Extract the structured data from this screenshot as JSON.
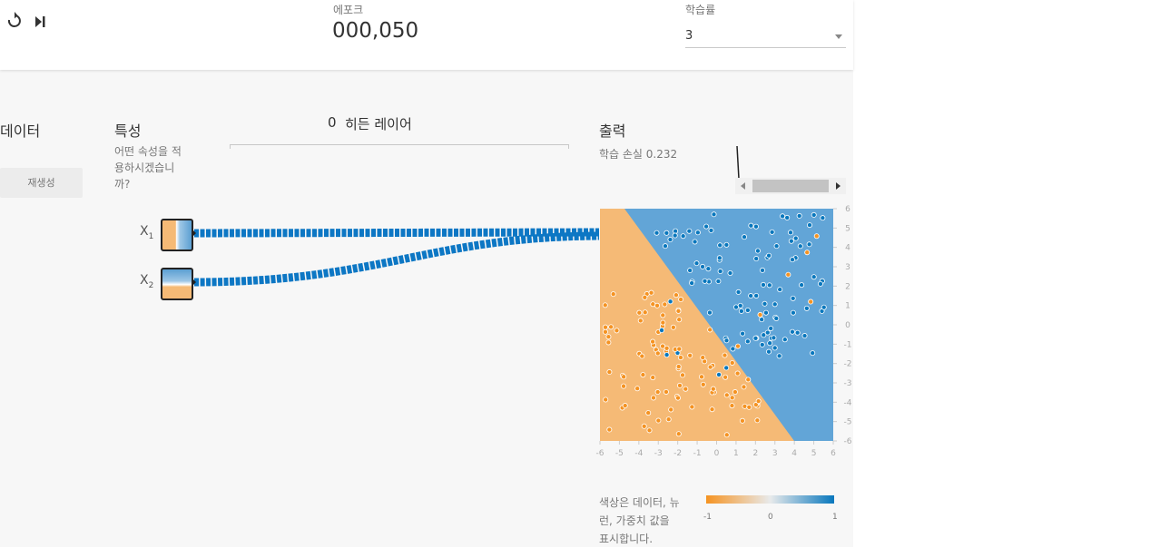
{
  "header": {
    "epoch_label": "에포크",
    "epoch_value": "000,050",
    "learning_rate_label": "학습률",
    "learning_rate_value": "3",
    "icons": [
      "reset-icon",
      "step-icon"
    ]
  },
  "data_column": {
    "title": "데이터",
    "regenerate_label": "재생성"
  },
  "features_column": {
    "title": "특성",
    "description": "어떤 속성을 적용하시겠습니까?",
    "description_lines": [
      "어떤 속성을 적",
      "용하시겠습니",
      "까?"
    ],
    "inputs": [
      {
        "base": "X",
        "sub": "1"
      },
      {
        "base": "X",
        "sub": "2"
      }
    ]
  },
  "hidden_layers": {
    "count": "0",
    "label": "히든 레이어"
  },
  "output": {
    "title": "출력",
    "loss_text": "학습 손실 0.232",
    "y_ticks": [
      "6",
      "5",
      "4",
      "3",
      "2",
      "1",
      "0",
      "-1",
      "-2",
      "-3",
      "-4",
      "-5",
      "-6"
    ],
    "x_ticks": [
      "-6",
      "-5",
      "-4",
      "-3",
      "-2",
      "-1",
      "0",
      "1",
      "2",
      "3",
      "4",
      "5",
      "6"
    ],
    "legend": {
      "description_lines": [
        "색상은 데이터, 뉴",
        "런, 가중치 값을",
        "표시합니다."
      ],
      "min_label": "-1",
      "mid_label": "0",
      "max_label": "1"
    }
  },
  "colors": {
    "orange": "#f59322",
    "orange_light": "#f5ba76",
    "blue": "#0877bd",
    "blue_region": "#62a5d7",
    "link": "#0d77c4"
  }
}
